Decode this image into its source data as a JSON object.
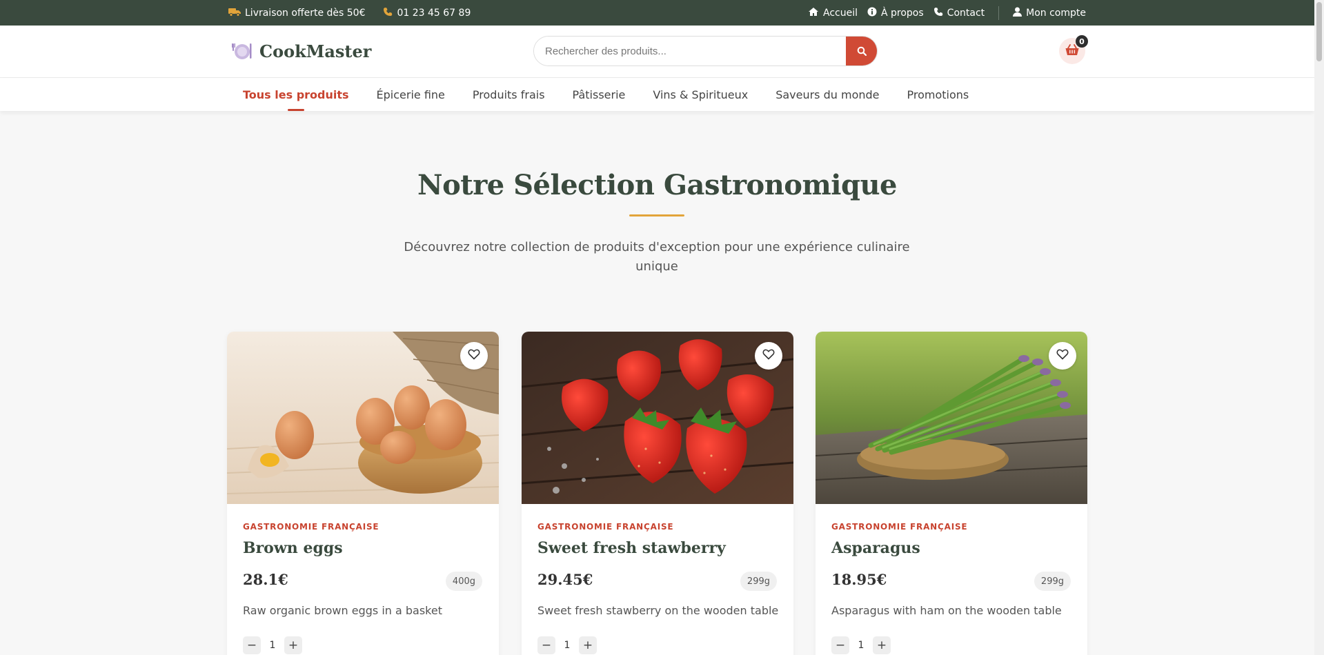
{
  "topbar": {
    "delivery": "Livraison offerte dès 50€",
    "phone": "01 23 45 67 89",
    "links": [
      "Accueil",
      "À propos",
      "Contact"
    ],
    "account": "Mon compte"
  },
  "header": {
    "brand": "CookMaster",
    "search_placeholder": "Rechercher des produits...",
    "cart_count": "0"
  },
  "nav": {
    "items": [
      "Tous les produits",
      "Épicerie fine",
      "Produits frais",
      "Pâtisserie",
      "Vins & Spiritueux",
      "Saveurs du monde",
      "Promotions"
    ],
    "active_index": 0
  },
  "hero": {
    "title": "Notre Sélection Gastronomique",
    "subtitle": "Découvrez notre collection de produits d'exception pour une expérience culinaire unique"
  },
  "products": [
    {
      "category": "GASTRONOMIE FRANÇAISE",
      "name": "Brown eggs",
      "price": "28.1€",
      "weight": "400g",
      "description": "Raw organic brown eggs in a basket",
      "quantity": "1"
    },
    {
      "category": "GASTRONOMIE FRANÇAISE",
      "name": "Sweet fresh stawberry",
      "price": "29.45€",
      "weight": "299g",
      "description": "Sweet fresh stawberry on the wooden table",
      "quantity": "1"
    },
    {
      "category": "GASTRONOMIE FRANÇAISE",
      "name": "Asparagus",
      "price": "18.95€",
      "weight": "299g",
      "description": "Asparagus with ham on the wooden table",
      "quantity": "1"
    }
  ],
  "colors": {
    "topbar": "#3a4a3e",
    "accent_red": "#c8432f",
    "accent_gold": "#e2a43a",
    "heading_green": "#3a4a3e"
  },
  "icons": {
    "delivery": "truck-icon",
    "phone": "phone-icon",
    "home": "home-icon",
    "about": "info-icon",
    "contact": "phone-icon",
    "account": "user-icon",
    "search": "search-icon",
    "cart": "basket-icon",
    "favorite": "heart-icon"
  }
}
